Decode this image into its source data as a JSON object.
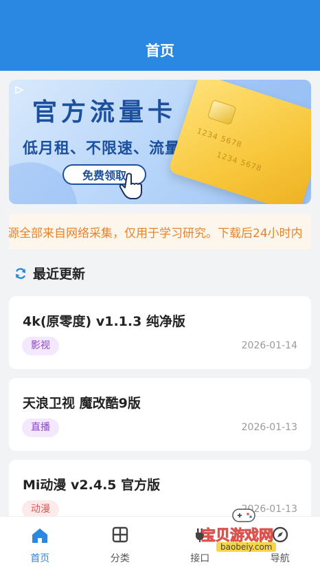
{
  "header": {
    "title": "首页"
  },
  "banner": {
    "title": "官方流量卡",
    "subtitle": "低月租、不限速、流量多",
    "button_label": "免费领取",
    "card_numbers": [
      "1234  5678",
      "1234  5678"
    ]
  },
  "notice": {
    "text": "源全部来自网络采集，仅用于学习研究。下载后24小时内"
  },
  "section": {
    "title": "最近更新"
  },
  "items": [
    {
      "title": "4k(原零度) v1.1.3 纯净版",
      "tag": "影视",
      "date": "2026-01-14"
    },
    {
      "title": "天浪卫视 魔改酷9版",
      "tag": "直播",
      "date": "2026-01-13"
    },
    {
      "title": "Mi动漫 v2.4.5 官方版",
      "tag": "动漫",
      "date": "2026-01-13"
    }
  ],
  "tabbar": {
    "tabs": [
      {
        "label": "首页",
        "icon": "home-icon"
      },
      {
        "label": "分类",
        "icon": "grid-icon"
      },
      {
        "label": "接口",
        "icon": "plug-icon"
      },
      {
        "label": "导航",
        "icon": "compass-icon"
      }
    ]
  },
  "watermark": {
    "text": "宝贝游戏网",
    "url": "baobeiy.com"
  },
  "colors": {
    "primary": "#2a87e2",
    "notice_text": "#e6842c",
    "notice_bg": "#fdf6ec"
  }
}
